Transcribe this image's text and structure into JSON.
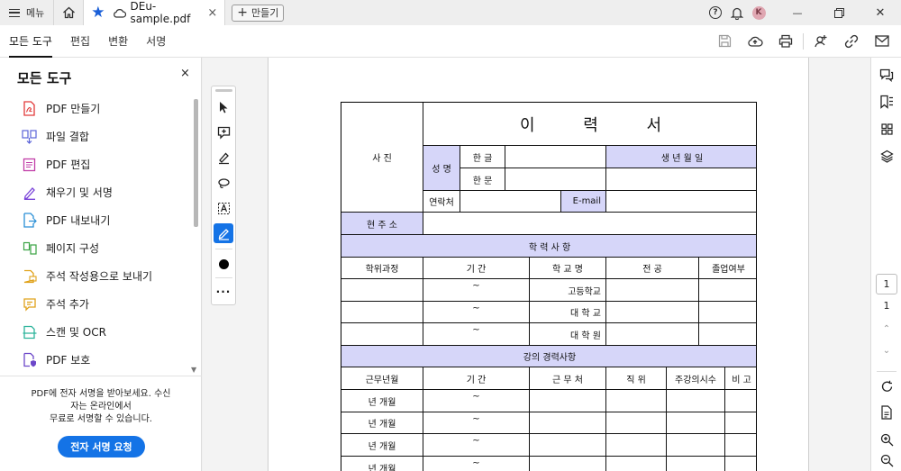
{
  "titlebar": {
    "menu_label": "메뉴",
    "tab_title": "DEu-sample.pdf",
    "tab_close": "×",
    "new_button_label": "만들기",
    "help_icon": "?",
    "avatar_initial": "K",
    "minimize": "—",
    "close": "✕"
  },
  "nav": {
    "tabs": [
      {
        "label": "모든 도구",
        "active": true
      },
      {
        "label": "편집",
        "active": false
      },
      {
        "label": "변환",
        "active": false
      },
      {
        "label": "서명",
        "active": false
      }
    ]
  },
  "left_panel": {
    "title": "모든 도구",
    "close": "×",
    "items": [
      {
        "label": "PDF 만들기",
        "icon": "create-pdf-icon",
        "color": "#e23a3a"
      },
      {
        "label": "파일 결합",
        "icon": "combine-files-icon",
        "color": "#5a63d8"
      },
      {
        "label": "PDF 편집",
        "icon": "edit-pdf-icon",
        "color": "#c13ea8"
      },
      {
        "label": "채우기 및 서명",
        "icon": "fill-sign-icon",
        "color": "#7b45d9"
      },
      {
        "label": "PDF 내보내기",
        "icon": "export-pdf-icon",
        "color": "#2a8fd6"
      },
      {
        "label": "페이지 구성",
        "icon": "organize-pages-icon",
        "color": "#3aa344"
      },
      {
        "label": "주석 작성용으로 보내기",
        "icon": "send-comment-icon",
        "color": "#e0a21a"
      },
      {
        "label": "주석 추가",
        "icon": "add-comment-icon",
        "color": "#e0a21a"
      },
      {
        "label": "스캔 및 OCR",
        "icon": "scan-ocr-icon",
        "color": "#2bb39b"
      },
      {
        "label": "PDF 보호",
        "icon": "protect-pdf-icon",
        "color": "#6c47c9"
      }
    ],
    "promo_line1": "PDF에 전자 서명을 받아보세요. 수신",
    "promo_line2": "자는 온라인에서",
    "promo_line3": "무료로 서명할 수 있습니다.",
    "promo_button": "전자 서명 요청"
  },
  "document": {
    "title": "이 력 서",
    "photo": "사 진",
    "name": "성 명",
    "hangul": "한 글",
    "hanja": "한 문",
    "birth": "생 년 월 일",
    "contact": "연락처",
    "email": "E-mail",
    "address": "현 주 소",
    "education_header": "학 력 사 항",
    "edu_cols": [
      "학위과정",
      "기 간",
      "학 교 명",
      "전 공",
      "졸업여부"
    ],
    "edu_rows": [
      {
        "period": "~",
        "school": "고등학교"
      },
      {
        "period": "~",
        "school": "대 학 교"
      },
      {
        "period": "~",
        "school": "대 학 원"
      }
    ],
    "career_header": "강의 경력사항",
    "career_cols": [
      "근무년월",
      "기 간",
      "근 무 처",
      "직 위",
      "주강의시수",
      "비 고"
    ],
    "career_rows": [
      {
        "ym": "년    개월",
        "period": "~"
      },
      {
        "ym": "년    개월",
        "period": "~"
      },
      {
        "ym": "년    개월",
        "period": "~"
      },
      {
        "ym": "년    개월",
        "period": "~"
      }
    ]
  },
  "pagination": {
    "current": "1",
    "total": "1"
  },
  "colors": {
    "accent": "#1473e6",
    "table_shade": "#d6d6f9"
  }
}
